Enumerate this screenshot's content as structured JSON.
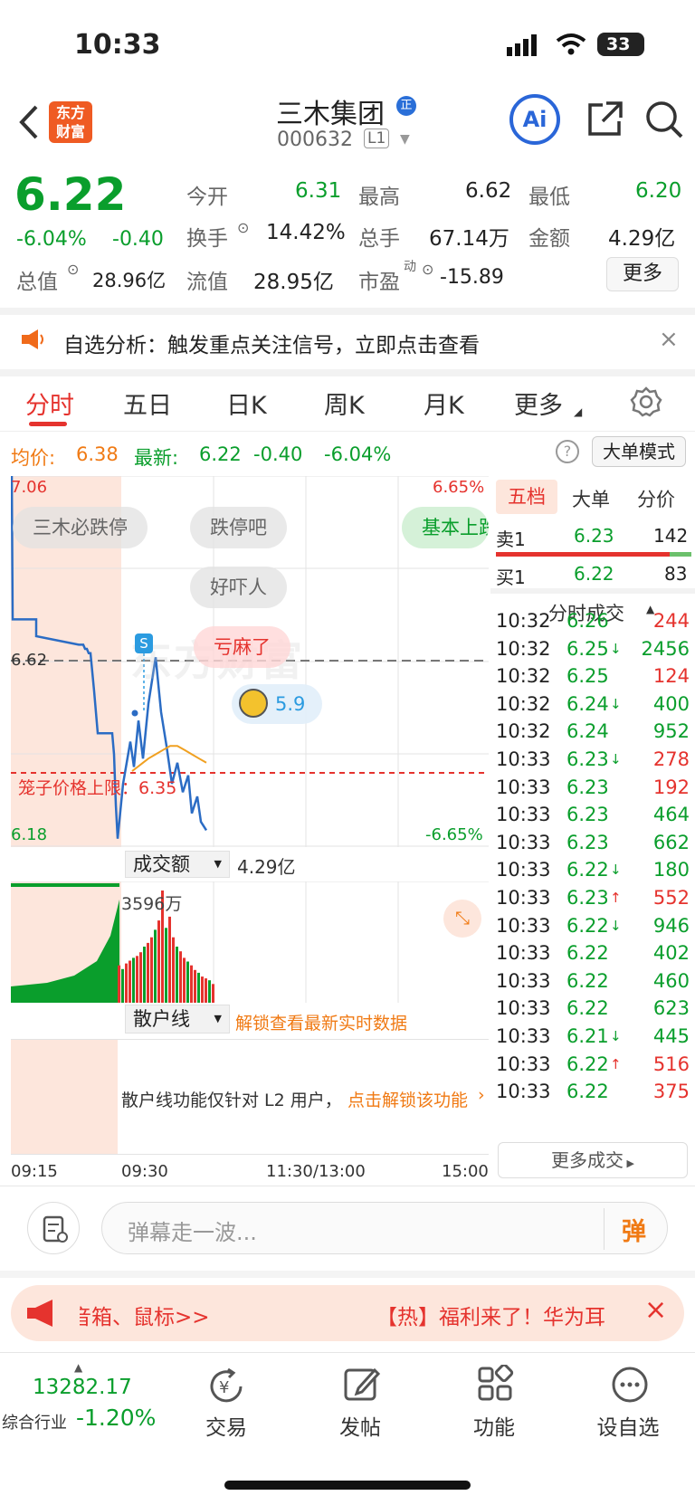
{
  "status_bar": {
    "time": "10:33",
    "battery": "33"
  },
  "header": {
    "logo_line1": "东方",
    "logo_line2": "财富",
    "stock_name": "三木集团",
    "badge": "正",
    "stock_code": "000632",
    "level": "L1",
    "ai_label": "Ai"
  },
  "quote": {
    "price": "6.22",
    "change_pct": "-6.04%",
    "change": "-0.40",
    "open_label": "今开",
    "open": "6.31",
    "high_label": "最高",
    "high": "6.62",
    "low_label": "最低",
    "low": "6.20",
    "turnover_label": "换手",
    "turnover": "14.42%",
    "volume_label": "总手",
    "volume": "67.14万",
    "amount_label": "金额",
    "amount": "4.29亿",
    "mcap_label": "总值",
    "mcap": "28.96亿",
    "float_label": "流值",
    "float_cap": "28.95亿",
    "pe_label": "市盈",
    "pe_sup": "动",
    "pe": "-15.89",
    "more_label": "更多"
  },
  "banner": {
    "text": "自选分析：触发重点关注信号，立即点击查看"
  },
  "tabs": [
    "分时",
    "五日",
    "日K",
    "周K",
    "月K",
    "更多"
  ],
  "chart_header": {
    "avg_label": "均价:",
    "avg": "6.38",
    "latest_label": "最新:",
    "latest": "6.22",
    "latest_change": "-0.40",
    "latest_pct": "-6.04%",
    "mode_label": "大单模式"
  },
  "chart_data": {
    "type": "line",
    "y_top": "7.06",
    "y_ref": "6.62",
    "y_bottom": "6.18",
    "pct_top": "6.65%",
    "pct_bottom": "-6.65%",
    "ylim": [
      6.18,
      7.06
    ],
    "limit_label": "笼子价格上限：6.35",
    "limit_value": 6.35,
    "s_marker": "S",
    "x_ticks": [
      "09:15",
      "09:30",
      "11:30/13:00",
      "15:00"
    ],
    "series": [
      {
        "values": [
          7.06,
          6.72,
          6.72,
          6.68,
          6.66,
          6.66,
          6.66,
          6.65,
          6.65,
          6.64,
          6.64,
          6.55,
          6.45,
          6.45,
          6.4,
          6.28,
          6.2,
          6.33,
          6.43,
          6.37,
          6.48,
          6.39,
          6.52,
          6.63,
          6.5,
          6.42,
          6.33,
          6.38,
          6.31,
          6.35,
          6.26,
          6.3,
          6.24,
          6.22
        ]
      },
      {
        "values": [
          6.36,
          6.37,
          6.38,
          6.39,
          6.4,
          6.41,
          6.42,
          6.42,
          6.41,
          6.4,
          6.39,
          6.38
        ]
      }
    ]
  },
  "bubbles": [
    "三木必跌停",
    "跌停吧",
    "基本上跌",
    "好吓人",
    "亏麻了"
  ],
  "rating_value": "5.9",
  "watermark": "东方财富",
  "volume_panel": {
    "selector": "成交额",
    "total": "4.29亿",
    "peak_label": "3596万",
    "bars": [
      40,
      36,
      42,
      45,
      48,
      50,
      54,
      60,
      64,
      70,
      78,
      88,
      120,
      80,
      92,
      70,
      60,
      55,
      48,
      44,
      40,
      35,
      32,
      28,
      26,
      24,
      20
    ]
  },
  "retail_panel": {
    "selector": "散户线",
    "unlock_text": "解锁查看最新实时数据",
    "notice": "散户线功能仅针对 L2 用户，",
    "notice_link": "点击解锁该功能"
  },
  "order_book": {
    "tabs": [
      "五档",
      "大单",
      "分价"
    ],
    "sell": {
      "label": "卖1",
      "price": "6.23",
      "vol": "142"
    },
    "buy": {
      "label": "买1",
      "price": "6.22",
      "vol": "83"
    },
    "trades_label": "分时成交",
    "trades": [
      {
        "t": "10:32",
        "p": "6.26",
        "a": "",
        "v": "244",
        "c": "red"
      },
      {
        "t": "10:32",
        "p": "6.25",
        "a": "↓",
        "v": "2456",
        "c": "green"
      },
      {
        "t": "10:32",
        "p": "6.25",
        "a": "",
        "v": "124",
        "c": "red"
      },
      {
        "t": "10:32",
        "p": "6.24",
        "a": "↓",
        "v": "400",
        "c": "green"
      },
      {
        "t": "10:32",
        "p": "6.24",
        "a": "",
        "v": "952",
        "c": "green"
      },
      {
        "t": "10:33",
        "p": "6.23",
        "a": "↓",
        "v": "278",
        "c": "red"
      },
      {
        "t": "10:33",
        "p": "6.23",
        "a": "",
        "v": "192",
        "c": "red"
      },
      {
        "t": "10:33",
        "p": "6.23",
        "a": "",
        "v": "464",
        "c": "green"
      },
      {
        "t": "10:33",
        "p": "6.23",
        "a": "",
        "v": "662",
        "c": "green"
      },
      {
        "t": "10:33",
        "p": "6.22",
        "a": "↓",
        "v": "180",
        "c": "green"
      },
      {
        "t": "10:33",
        "p": "6.23",
        "a": "↑",
        "v": "552",
        "c": "red"
      },
      {
        "t": "10:33",
        "p": "6.22",
        "a": "↓",
        "v": "946",
        "c": "green"
      },
      {
        "t": "10:33",
        "p": "6.22",
        "a": "",
        "v": "402",
        "c": "green"
      },
      {
        "t": "10:33",
        "p": "6.22",
        "a": "",
        "v": "460",
        "c": "green"
      },
      {
        "t": "10:33",
        "p": "6.22",
        "a": "",
        "v": "623",
        "c": "green"
      },
      {
        "t": "10:33",
        "p": "6.21",
        "a": "↓",
        "v": "445",
        "c": "green"
      },
      {
        "t": "10:33",
        "p": "6.22",
        "a": "↑",
        "v": "516",
        "c": "red"
      },
      {
        "t": "10:33",
        "p": "6.22",
        "a": "",
        "v": "375",
        "c": "red"
      }
    ],
    "more_trades": "更多成交"
  },
  "comment_bar": {
    "placeholder": "弹幕走一波...",
    "send_label": "弹"
  },
  "promo": {
    "left_text": "音箱、鼠标>>",
    "right_text": "【热】福利来了！华为耳"
  },
  "bottom_nav": {
    "index_value": "13282.17",
    "index_name": "综合行业",
    "index_change": "-1.20%",
    "trade": "交易",
    "post": "发帖",
    "features": "功能",
    "watchlist": "设自选"
  },
  "colors": {
    "up": "#e5332e",
    "down": "#0a9e2c",
    "accent": "#f07a14",
    "line": "#2b6cc4"
  }
}
